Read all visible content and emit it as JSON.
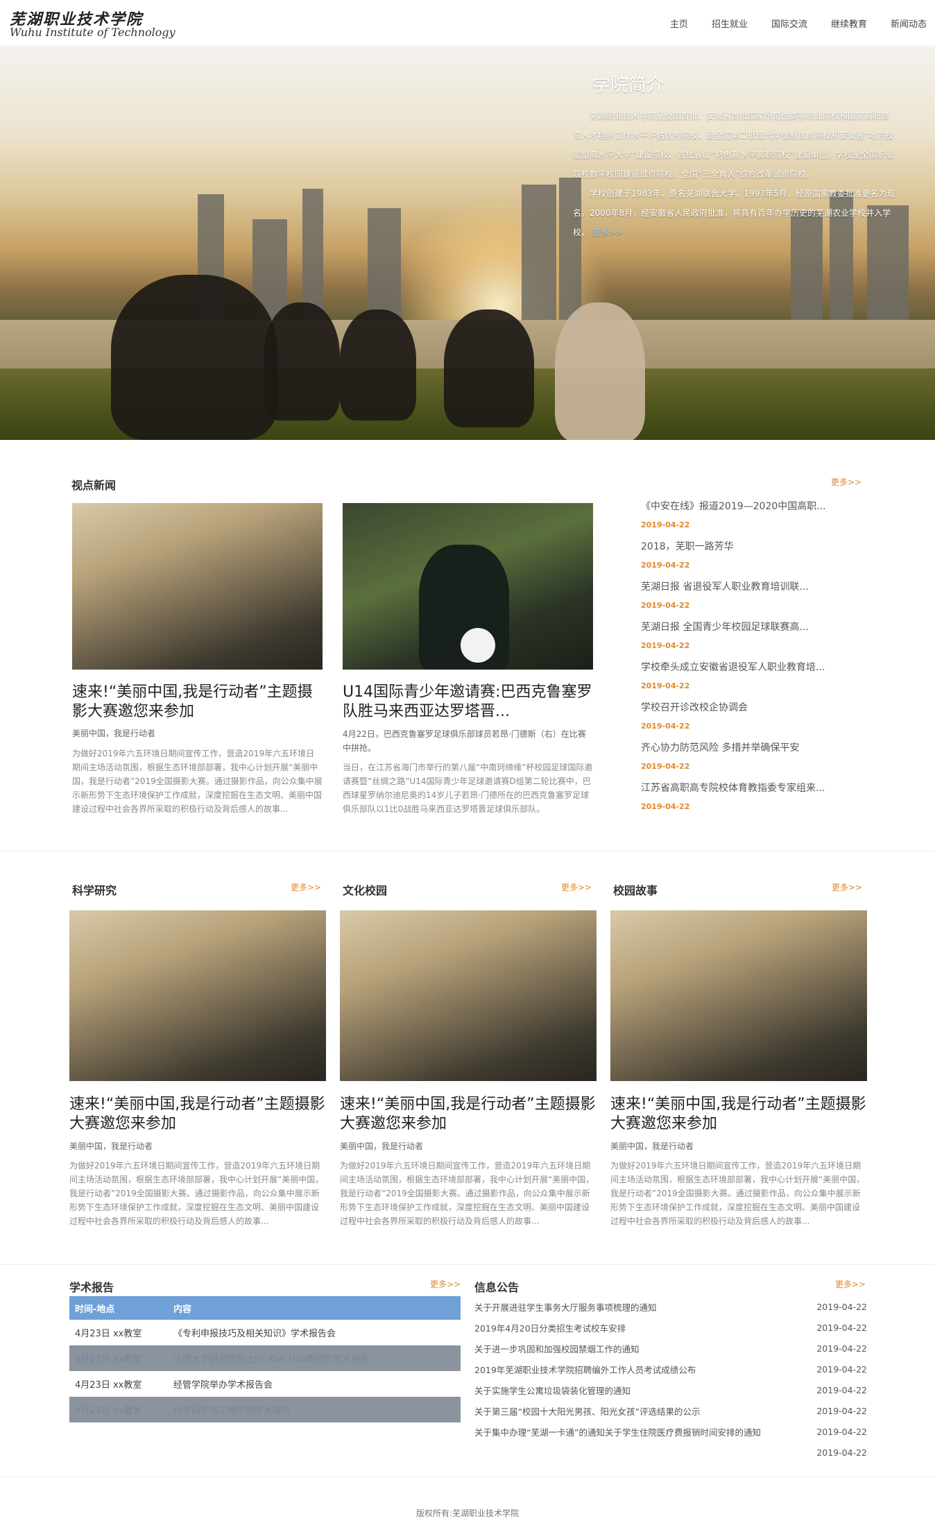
{
  "header": {
    "logo_cn": "芜湖职业技术学院",
    "logo_en": "Wuhu Institute of Technology",
    "nav": [
      "主页",
      "招生就业",
      "国际交流",
      "继续教育",
      "新闻动态"
    ]
  },
  "hero": {
    "title": "学院简介",
    "para1": "芜湖职业技术学院是全国首批、安徽省首批国家示范性高等职业院校和国家高职高专人才培养工作水平评估优秀院校，是全国第二批现代学徒制试点院校和安徽省“地方技能型高水平大学”建设院校、首批省级“特色高水平高职院校”建设单位。学校是全国职业院校数字校园建设试点院校、全国“三全育人”综合改革试点院校。",
    "para2": "学校创建于1983年，原名芜湖联合大学。1997年5月，经原国家教委批准更名为现名。2000年8月，经安徽省人民政府批准，将具有百年办学历史的芜湖农业学校并入学校。",
    "more": "更多>>"
  },
  "viewpoint": {
    "title": "视点新闻",
    "more": "更多>>",
    "cards": [
      {
        "title": "速来!“美丽中国,我是行动者”主题摄影大赛邀您来参加",
        "sub": "美丽中国，我是行动者",
        "body": "为做好2019年六五环境日期间宣传工作，营造2019年六五环境日期间主场活动氛围，根据生态环境部部署，我中心计划开展“美丽中国，我是行动者”2019全国摄影大赛。通过摄影作品，向公众集中展示新形势下生态环境保护工作成就，深度挖掘在生态文明、美丽中国建设过程中社会各界所采取的积极行动及背后感人的故事..."
      },
      {
        "title": "U14国际青少年邀请赛:巴西克鲁塞罗队胜马来西亚达罗塔晋...",
        "sub": "4月22日，巴西克鲁塞罗足球俱乐部球员若昂·门德斯（右）在比赛中拼抢。",
        "body": "当日，在江苏省海门市举行的第八届“中南珂缔缘”杯校园足球国际邀请赛暨“丝绸之路”U14国际青少年足球邀请赛D组第二轮比赛中，巴西球星罗纳尔迪尼奥的14岁儿子若昂·门德所在的巴西克鲁塞罗足球俱乐部队以1比0战胜马来西亚达罗塔晋足球俱乐部队。"
      }
    ],
    "list": [
      {
        "title": "《中安在线》报道2019—2020中国高职...",
        "date": "2019-04-22"
      },
      {
        "title": "2018，芜职一路芳华",
        "date": "2019-04-22"
      },
      {
        "title": "芜湖日报 省退役军人职业教育培训联...",
        "date": "2019-04-22"
      },
      {
        "title": "芜湖日报 全国青少年校园足球联赛高...",
        "date": "2019-04-22"
      },
      {
        "title": "学校牵头成立安徽省退役军人职业教育培...",
        "date": "2019-04-22"
      },
      {
        "title": "学校召开诊改校企协调会",
        "date": "2019-04-22"
      },
      {
        "title": "齐心协力防范风险 多措并举确保平安",
        "date": "2019-04-22"
      },
      {
        "title": "江苏省高职高专院校体育教指委专家组来...",
        "date": "2019-04-22"
      }
    ]
  },
  "columns": [
    {
      "title": "科学研究",
      "more": "更多>>",
      "card_title": "速来!“美丽中国,我是行动者”主题摄影大赛邀您来参加",
      "sub": "美丽中国，我是行动者",
      "body": "为做好2019年六五环境日期间宣传工作，营造2019年六五环境日期间主场活动氛围，根据生态环境部部署，我中心计划开展“美丽中国，我是行动者”2019全国摄影大赛。通过摄影作品，向公众集中展示新形势下生态环境保护工作成就，深度挖掘在生态文明、美丽中国建设过程中社会各界所采取的积极行动及背后感人的故事..."
    },
    {
      "title": "文化校园",
      "more": "更多>>",
      "card_title": "速来!“美丽中国,我是行动者”主题摄影大赛邀您来参加",
      "sub": "美丽中国，我是行动者",
      "body": "为做好2019年六五环境日期间宣传工作，营造2019年六五环境日期间主场活动氛围，根据生态环境部部署，我中心计划开展“美丽中国，我是行动者”2019全国摄影大赛。通过摄影作品，向公众集中展示新形势下生态环境保护工作成就，深度挖掘在生态文明、美丽中国建设过程中社会各界所采取的积极行动及背后感人的故事..."
    },
    {
      "title": "校园故事",
      "more": "更多>>",
      "card_title": "速来!“美丽中国,我是行动者”主题摄影大赛邀您来参加",
      "sub": "美丽中国，我是行动者",
      "body": "为做好2019年六五环境日期间宣传工作，营造2019年六五环境日期间主场活动氛围，根据生态环境部部署，我中心计划开展“美丽中国，我是行动者”2019全国摄影大赛。通过摄影作品，向公众集中展示新形势下生态环境保护工作成就，深度挖掘在生态文明、美丽中国建设过程中社会各界所采取的积极行动及背后感人的故事..."
    }
  ],
  "report": {
    "title": "学术报告",
    "more": "更多>>",
    "head_time": "时间-地点",
    "head_content": "内容",
    "rows": [
      {
        "time": "4月23日 xx教室",
        "content": "《专利申报技巧及相关知识》学术报告会"
      },
      {
        "time": "4月23日 xx教室",
        "content": "法国大学研究院院士Jin-Kao Hao教授作学术报告"
      },
      {
        "time": "4月23日 xx教室",
        "content": "经管学院举办学术报告会"
      },
      {
        "time": "4月23日 xx教室",
        "content": "化学科学与工程学院学术报告"
      }
    ]
  },
  "notice": {
    "title": "信息公告",
    "more": "更多>>",
    "rows": [
      {
        "text": "关于开展进驻学生事务大厅服务事项梳理的通知",
        "date": "2019-04-22"
      },
      {
        "text": "2019年4月20日分类招生考试校车安排",
        "date": "2019-04-22"
      },
      {
        "text": "关于进一步巩固和加强校园禁烟工作的通知",
        "date": "2019-04-22"
      },
      {
        "text": "2019年芜湖职业技术学院招聘编外工作人员考试成绩公布",
        "date": "2019-04-22"
      },
      {
        "text": "关于实施学生公寓垃圾袋装化管理的通知",
        "date": "2019-04-22"
      },
      {
        "text": "关于第三届“校园十大阳光男孩、阳光女孩”评选结果的公示",
        "date": "2019-04-22"
      },
      {
        "text": "关于集中办理“芜湖一卡通”的通知关于学生住院医疗费报销时间安排的通知",
        "date": "2019-04-22"
      },
      {
        "text": "",
        "date": "2019-04-22"
      }
    ]
  },
  "footer": {
    "text": "版权所有:芜湖职业技术学院"
  }
}
